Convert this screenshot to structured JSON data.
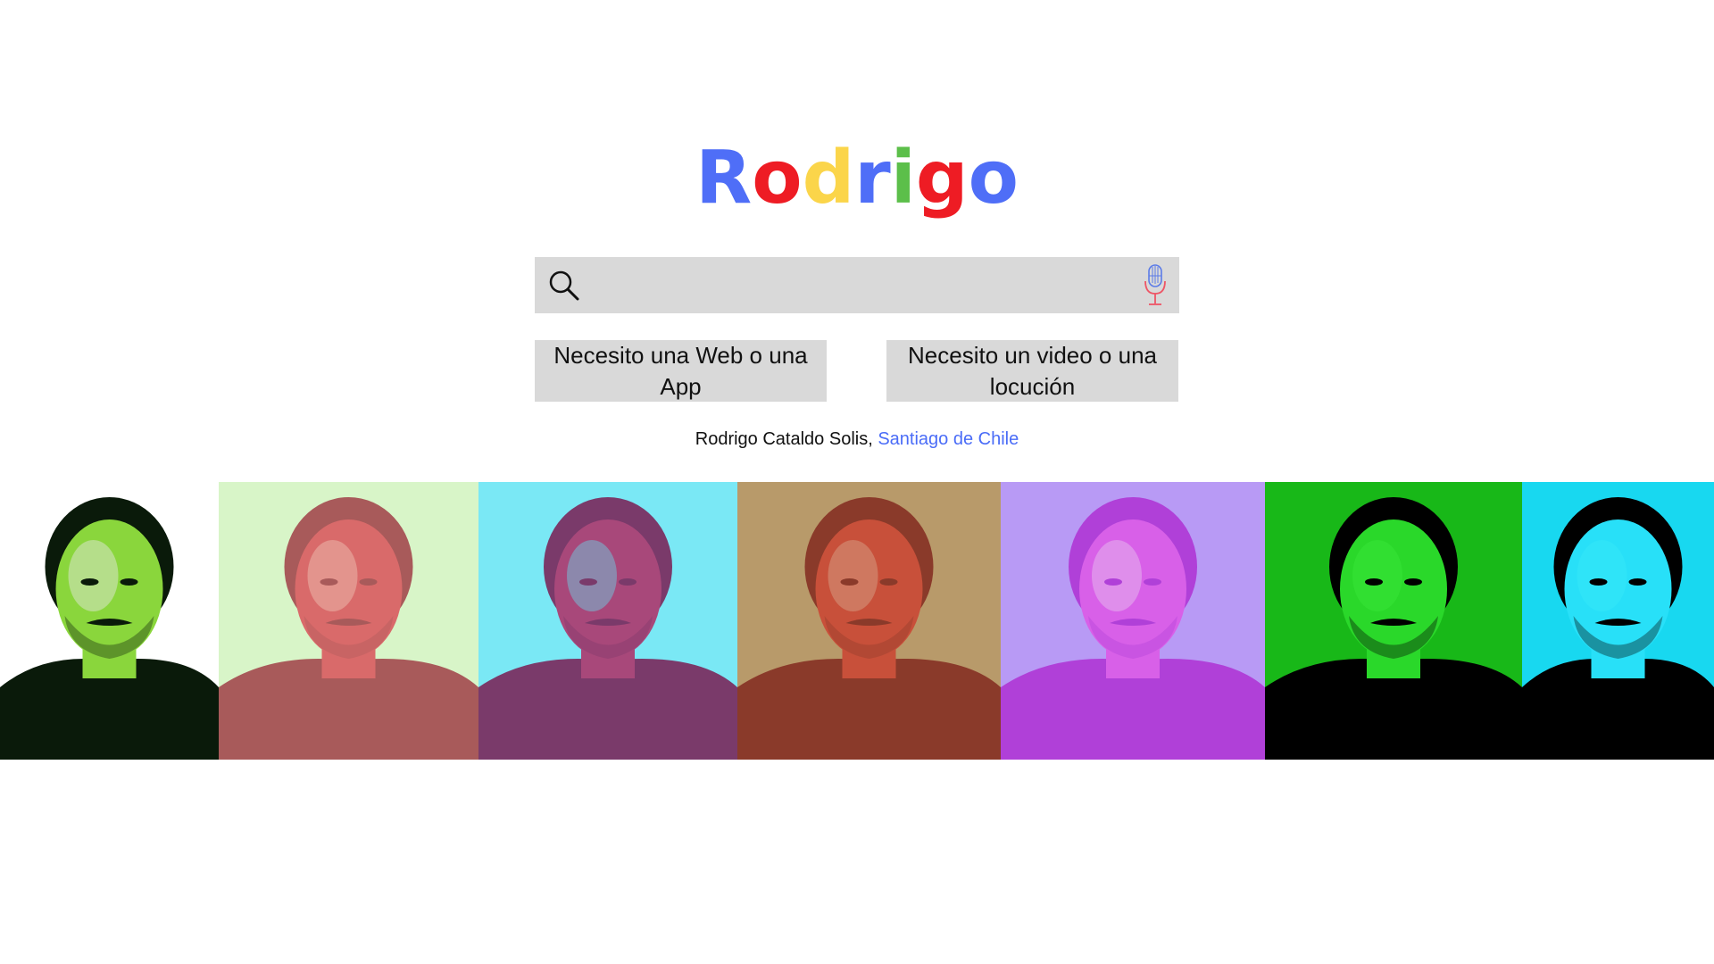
{
  "logo": {
    "letters": [
      {
        "char": "R",
        "color": "#4f6ef7"
      },
      {
        "char": "o",
        "color": "#ee1c24"
      },
      {
        "char": "d",
        "color": "#fbd54a"
      },
      {
        "char": "r",
        "color": "#4f6ef7"
      },
      {
        "char": "i",
        "color": "#5cbf4a"
      },
      {
        "char": "g",
        "color": "#ee1c24"
      },
      {
        "char": "o",
        "color": "#4f6ef7"
      }
    ]
  },
  "search": {
    "value": "",
    "placeholder": "",
    "bar_color": "#d9d9d9"
  },
  "buttons": {
    "web_label": "Necesito una Web o una App",
    "video_label": "Necesito un video o una locución"
  },
  "credit": {
    "name": "Rodrigo Cataldo Solis, ",
    "location": "Santiago de Chile",
    "link_color": "#4a6cf7"
  },
  "gallery": {
    "tiles": [
      {
        "bg": "#ffffff",
        "tint": "#8ad63c",
        "shadow": "#0a1a0a",
        "figure": "#e8e8e8"
      },
      {
        "bg": "#d8f5c8",
        "tint": "#d96a6a",
        "shadow": "#a85a5a",
        "figure": "#f0c8b8"
      },
      {
        "bg": "#7ae8f5",
        "tint": "#a8487a",
        "shadow": "#7a3a6a",
        "figure": "#6ad8e8"
      },
      {
        "bg": "#b89a6a",
        "tint": "#c8503a",
        "shadow": "#8a3a2a",
        "figure": "#d8a890"
      },
      {
        "bg": "#b89af5",
        "tint": "#d860e8",
        "shadow": "#b040d8",
        "figure": "#e8c8f0"
      },
      {
        "bg": "#18b818",
        "tint": "#2ad82a",
        "shadow": "#000000",
        "figure": "#3ae83a"
      },
      {
        "bg": "#18d8f0",
        "tint": "#28e0f8",
        "shadow": "#000000",
        "figure": "#38e8f8"
      }
    ]
  }
}
